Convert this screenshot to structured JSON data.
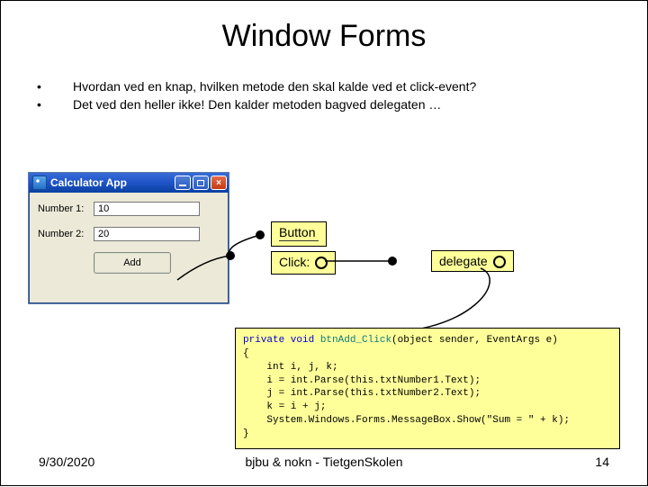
{
  "title": "Window Forms",
  "bullets": [
    "Hvordan ved en knap, hvilken metode den skal kalde ved et click-event?",
    "Det ved den heller ikke! Den kalder metoden bagved delegaten …"
  ],
  "calc": {
    "window_title": "Calculator App",
    "label1": "Number 1:",
    "label2": "Number 2:",
    "value1": "10",
    "value2": "20",
    "add_button": "Add"
  },
  "boxes": {
    "button": "Button",
    "click": "Click:",
    "delegate": "delegate"
  },
  "code": {
    "l1a": "private void ",
    "l1b": "btnAdd_Click",
    "l1c": "(object sender, EventArgs e)",
    "l2": "{",
    "l3": "    int i, j, k;",
    "l4": "    i = int.Parse(this.txtNumber1.Text);",
    "l5": "    j = int.Parse(this.txtNumber2.Text);",
    "l6": "    k = i + j;",
    "l7": "    System.Windows.Forms.MessageBox.Show(\"Sum = \" + k);",
    "l8": "}"
  },
  "footer": {
    "date": "9/30/2020",
    "center": "bjbu & nokn - TietgenSkolen",
    "page": "14"
  }
}
